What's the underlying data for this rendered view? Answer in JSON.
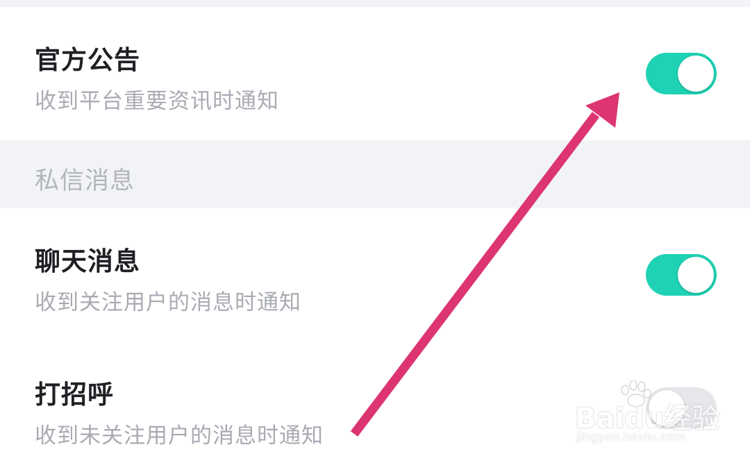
{
  "settings": {
    "official_announcement": {
      "title": "官方公告",
      "subtitle": "收到平台重要资讯时通知",
      "enabled": true
    },
    "section_private_messages": {
      "label": "私信消息"
    },
    "chat_messages": {
      "title": "聊天消息",
      "subtitle": "收到关注用户的消息时通知",
      "enabled": true
    },
    "greetings": {
      "title": "打招呼",
      "subtitle": "收到未关注用户的消息时通知",
      "enabled": false
    }
  },
  "colors": {
    "toggle_on": "#1fd2b4",
    "toggle_off": "#e6e7eb",
    "arrow": "#dc3572",
    "section_bg": "#f2f3f6"
  },
  "watermark": {
    "brand": "Baidu经验",
    "url": "jingyan.baidu.com"
  },
  "annotation": {
    "arrow_icon": "annotation-arrow-icon"
  }
}
